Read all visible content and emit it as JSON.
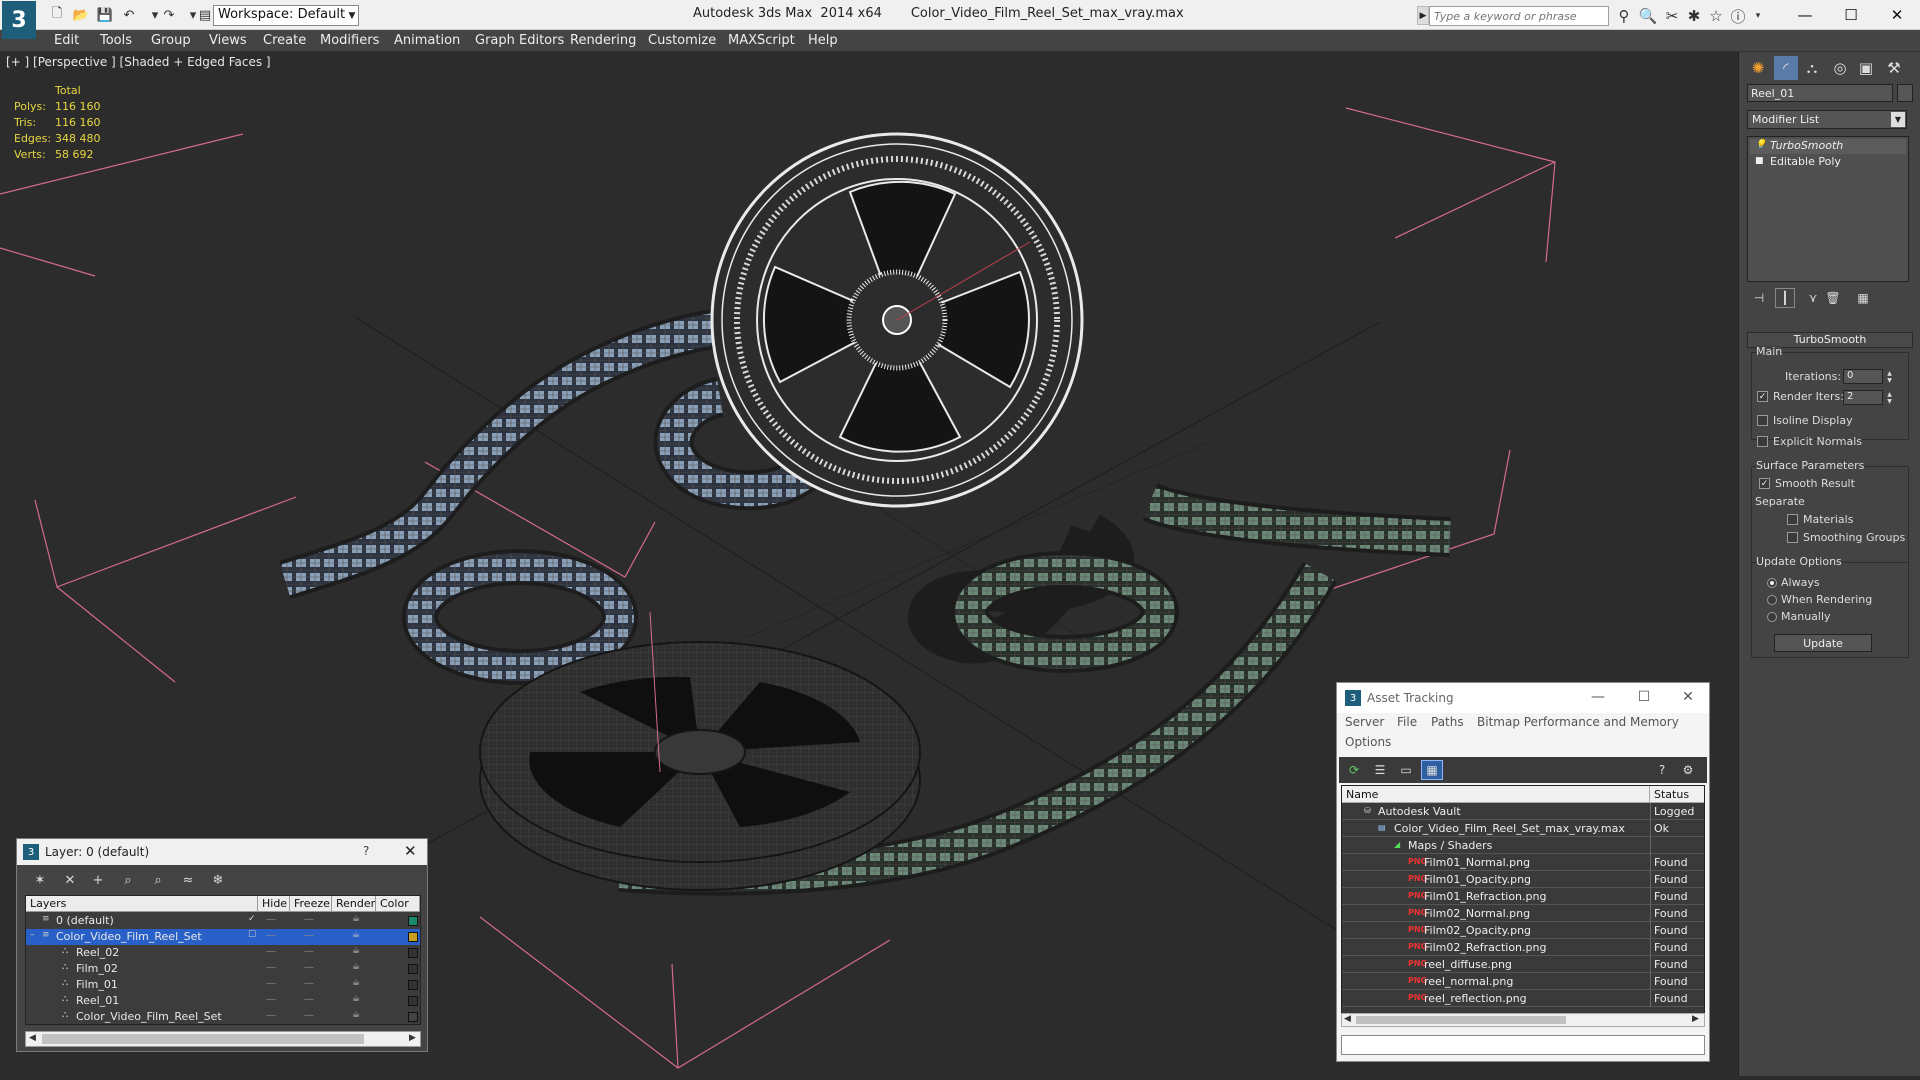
{
  "titlebar": {
    "workspace": "Workspace: Default",
    "app_name": "Autodesk 3ds Max  2014 x64",
    "file_name": "Color_Video_Film_Reel_Set_max_vray.max",
    "search_placeholder": "Type a keyword or phrase"
  },
  "menu": [
    "Edit",
    "Tools",
    "Group",
    "Views",
    "Create",
    "Modifiers",
    "Animation",
    "Graph Editors",
    "Rendering",
    "Customize",
    "MAXScript",
    "Help"
  ],
  "viewport": {
    "label": "[+ ] [Perspective ] [Shaded + Edged Faces ]",
    "stats": {
      "header": "Total",
      "rows": [
        {
          "label": "Polys:",
          "value": "116 160"
        },
        {
          "label": "Tris:",
          "value": "116 160"
        },
        {
          "label": "Edges:",
          "value": "348 480"
        },
        {
          "label": "Verts:",
          "value": "58 692"
        }
      ]
    }
  },
  "command_panel": {
    "object_name": "Reel_01",
    "modifier_list": "Modifier List",
    "stack": [
      "TurboSmooth",
      "Editable Poly"
    ],
    "rollout_title": "TurboSmooth",
    "main_group": "Main",
    "iterations_label": "Iterations:",
    "iterations_value": "0",
    "render_iters_label": "Render Iters:",
    "render_iters_value": "2",
    "isoline_display": "Isoline Display",
    "explicit_normals": "Explicit Normals",
    "surface_group": "Surface Parameters",
    "smooth_result": "Smooth Result",
    "separate_label": "Separate",
    "materials": "Materials",
    "smoothing_groups": "Smoothing Groups",
    "update_group": "Update Options",
    "always": "Always",
    "when_rendering": "When Rendering",
    "manually": "Manually",
    "update_button": "Update"
  },
  "layer_dialog": {
    "title": "Layer: 0 (default)",
    "help": "?",
    "columns": [
      "Layers",
      "Hide",
      "Freeze",
      "Render",
      "Color"
    ],
    "rows": [
      {
        "name": "0 (default)",
        "indent": 0,
        "color": "#1a8a6a",
        "selected": false,
        "active": true
      },
      {
        "name": "Color_Video_Film_Reel_Set",
        "indent": 0,
        "color": "#c8a020",
        "selected": true,
        "active": false
      },
      {
        "name": "Reel_02",
        "indent": 1,
        "color": "#333333",
        "selected": false,
        "active": false
      },
      {
        "name": "Film_02",
        "indent": 1,
        "color": "#333333",
        "selected": false,
        "active": false
      },
      {
        "name": "Film_01",
        "indent": 1,
        "color": "#333333",
        "selected": false,
        "active": false
      },
      {
        "name": "Reel_01",
        "indent": 1,
        "color": "#333333",
        "selected": false,
        "active": false
      },
      {
        "name": "Color_Video_Film_Reel_Set",
        "indent": 1,
        "color": "#444444",
        "selected": false,
        "active": false
      }
    ]
  },
  "asset_tracking": {
    "title": "Asset Tracking",
    "menu": [
      "Server",
      "File",
      "Paths",
      "Bitmap Performance and Memory",
      "Options"
    ],
    "columns": [
      "Name",
      "Status"
    ],
    "rows": [
      {
        "name": "Autodesk Vault",
        "status": "Logged",
        "level": 0,
        "icon": "vault"
      },
      {
        "name": "Color_Video_Film_Reel_Set_max_vray.max",
        "status": "Ok",
        "level": 1,
        "icon": "max"
      },
      {
        "name": "Maps / Shaders",
        "status": "",
        "level": 2,
        "icon": "maps"
      },
      {
        "name": "Film01_Normal.png",
        "status": "Found",
        "level": 3,
        "icon": "png"
      },
      {
        "name": "Film01_Opacity.png",
        "status": "Found",
        "level": 3,
        "icon": "png"
      },
      {
        "name": "Film01_Refraction.png",
        "status": "Found",
        "level": 3,
        "icon": "png"
      },
      {
        "name": "Film02_Normal.png",
        "status": "Found",
        "level": 3,
        "icon": "png"
      },
      {
        "name": "Film02_Opacity.png",
        "status": "Found",
        "level": 3,
        "icon": "png"
      },
      {
        "name": "Film02_Refraction.png",
        "status": "Found",
        "level": 3,
        "icon": "png"
      },
      {
        "name": "reel_diffuse.png",
        "status": "Found",
        "level": 3,
        "icon": "png"
      },
      {
        "name": "reel_normal.png",
        "status": "Found",
        "level": 3,
        "icon": "png"
      },
      {
        "name": "reel_reflection.png",
        "status": "Found",
        "level": 3,
        "icon": "png"
      }
    ]
  },
  "colors": {
    "stats_text": "#e8d640",
    "selection": "#2860c8",
    "grid": "#1e1e1e",
    "frame_lines": "#d56a8e"
  }
}
